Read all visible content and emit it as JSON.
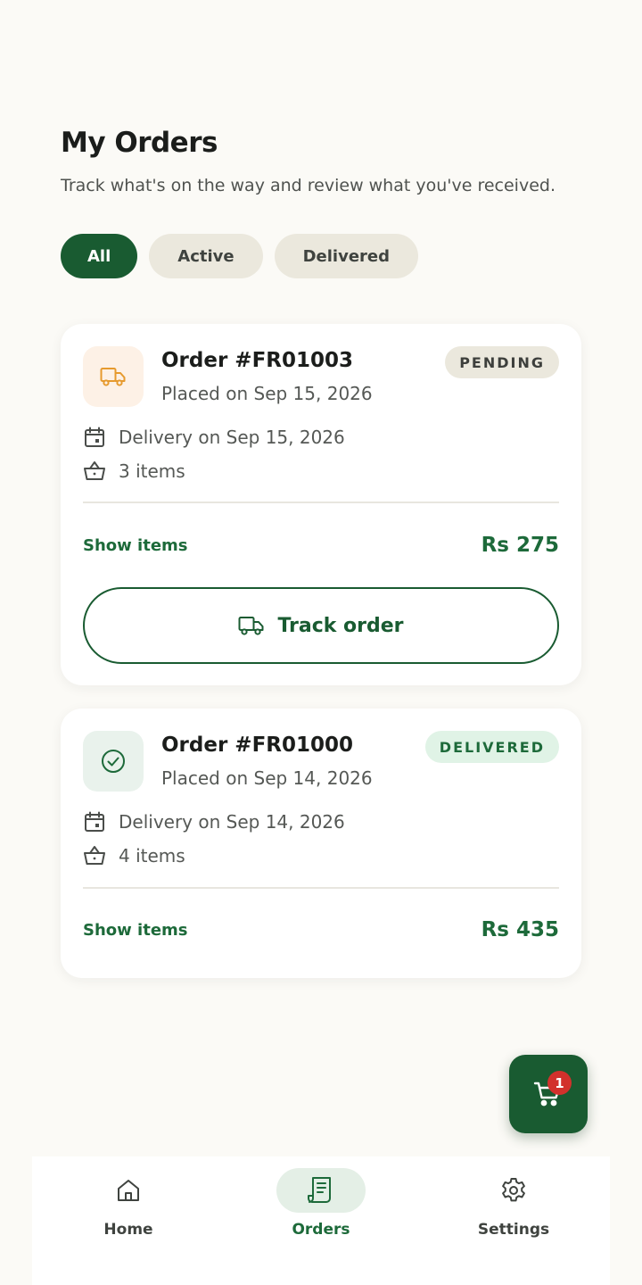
{
  "header": {
    "title": "My Orders",
    "subtitle": "Track what's on the way and review what you've received."
  },
  "filters": [
    {
      "label": "All",
      "selected": true
    },
    {
      "label": "Active",
      "selected": false
    },
    {
      "label": "Delivered",
      "selected": false
    }
  ],
  "orders": [
    {
      "title": "Order #FR01003",
      "placed": "Placed on Sep 15, 2026",
      "status": "PENDING",
      "status_icon": "truck-icon",
      "delivery": "Delivery on Sep 15, 2026",
      "items": "3 items",
      "show_items": "Show items",
      "price": "Rs 275",
      "track_label": "Track order"
    },
    {
      "title": "Order #FR01000",
      "placed": "Placed on Sep 14, 2026",
      "status": "DELIVERED",
      "status_icon": "check-circle-icon",
      "delivery": "Delivery on Sep 14, 2026",
      "items": "4 items",
      "show_items": "Show items",
      "price": "Rs 435"
    }
  ],
  "cart": {
    "count": "1",
    "icon": "cart-icon"
  },
  "nav": [
    {
      "label": "Home",
      "icon": "home-icon",
      "active": false
    },
    {
      "label": "Orders",
      "icon": "receipt-icon",
      "active": true
    },
    {
      "label": "Settings",
      "icon": "gear-icon",
      "active": false
    }
  ],
  "colors": {
    "brand_green": "#195b31",
    "accent_green": "#1d6a3a",
    "pending_orange": "#e69a2e",
    "badge_red": "#d2312c",
    "background": "#fbfaf6"
  }
}
